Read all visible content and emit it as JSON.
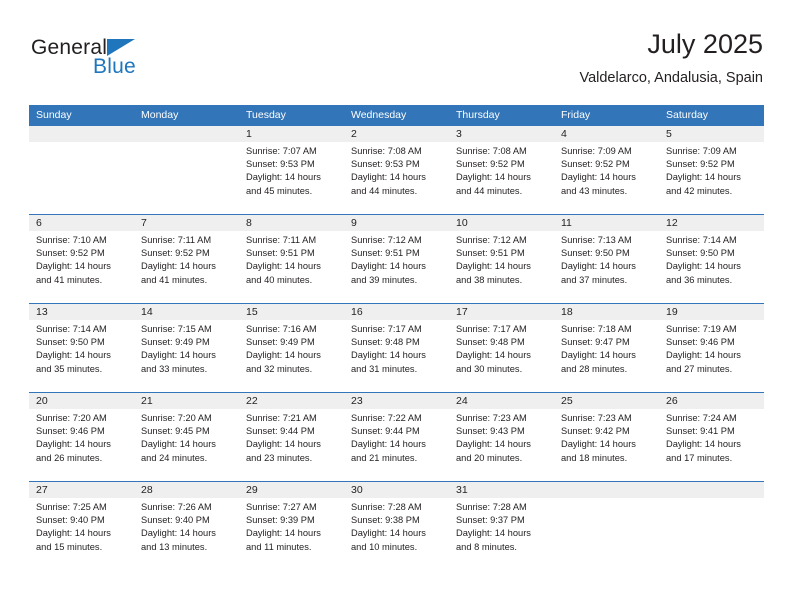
{
  "brand": {
    "name_dark": "General",
    "name_blue": "Blue",
    "accent_color": "#1f76bc"
  },
  "header": {
    "title": "July 2025",
    "subtitle": "Valdelarco, Andalusia, Spain"
  },
  "calendar": {
    "header_bg": "#3275b8",
    "daynum_bg": "#efefef",
    "weekday_headers": [
      "Sunday",
      "Monday",
      "Tuesday",
      "Wednesday",
      "Thursday",
      "Friday",
      "Saturday"
    ],
    "weeks": [
      [
        {
          "day": "",
          "lines": []
        },
        {
          "day": "",
          "lines": []
        },
        {
          "day": "1",
          "lines": [
            "Sunrise: 7:07 AM",
            "Sunset: 9:53 PM",
            "Daylight: 14 hours",
            "and 45 minutes."
          ]
        },
        {
          "day": "2",
          "lines": [
            "Sunrise: 7:08 AM",
            "Sunset: 9:53 PM",
            "Daylight: 14 hours",
            "and 44 minutes."
          ]
        },
        {
          "day": "3",
          "lines": [
            "Sunrise: 7:08 AM",
            "Sunset: 9:52 PM",
            "Daylight: 14 hours",
            "and 44 minutes."
          ]
        },
        {
          "day": "4",
          "lines": [
            "Sunrise: 7:09 AM",
            "Sunset: 9:52 PM",
            "Daylight: 14 hours",
            "and 43 minutes."
          ]
        },
        {
          "day": "5",
          "lines": [
            "Sunrise: 7:09 AM",
            "Sunset: 9:52 PM",
            "Daylight: 14 hours",
            "and 42 minutes."
          ]
        }
      ],
      [
        {
          "day": "6",
          "lines": [
            "Sunrise: 7:10 AM",
            "Sunset: 9:52 PM",
            "Daylight: 14 hours",
            "and 41 minutes."
          ]
        },
        {
          "day": "7",
          "lines": [
            "Sunrise: 7:11 AM",
            "Sunset: 9:52 PM",
            "Daylight: 14 hours",
            "and 41 minutes."
          ]
        },
        {
          "day": "8",
          "lines": [
            "Sunrise: 7:11 AM",
            "Sunset: 9:51 PM",
            "Daylight: 14 hours",
            "and 40 minutes."
          ]
        },
        {
          "day": "9",
          "lines": [
            "Sunrise: 7:12 AM",
            "Sunset: 9:51 PM",
            "Daylight: 14 hours",
            "and 39 minutes."
          ]
        },
        {
          "day": "10",
          "lines": [
            "Sunrise: 7:12 AM",
            "Sunset: 9:51 PM",
            "Daylight: 14 hours",
            "and 38 minutes."
          ]
        },
        {
          "day": "11",
          "lines": [
            "Sunrise: 7:13 AM",
            "Sunset: 9:50 PM",
            "Daylight: 14 hours",
            "and 37 minutes."
          ]
        },
        {
          "day": "12",
          "lines": [
            "Sunrise: 7:14 AM",
            "Sunset: 9:50 PM",
            "Daylight: 14 hours",
            "and 36 minutes."
          ]
        }
      ],
      [
        {
          "day": "13",
          "lines": [
            "Sunrise: 7:14 AM",
            "Sunset: 9:50 PM",
            "Daylight: 14 hours",
            "and 35 minutes."
          ]
        },
        {
          "day": "14",
          "lines": [
            "Sunrise: 7:15 AM",
            "Sunset: 9:49 PM",
            "Daylight: 14 hours",
            "and 33 minutes."
          ]
        },
        {
          "day": "15",
          "lines": [
            "Sunrise: 7:16 AM",
            "Sunset: 9:49 PM",
            "Daylight: 14 hours",
            "and 32 minutes."
          ]
        },
        {
          "day": "16",
          "lines": [
            "Sunrise: 7:17 AM",
            "Sunset: 9:48 PM",
            "Daylight: 14 hours",
            "and 31 minutes."
          ]
        },
        {
          "day": "17",
          "lines": [
            "Sunrise: 7:17 AM",
            "Sunset: 9:48 PM",
            "Daylight: 14 hours",
            "and 30 minutes."
          ]
        },
        {
          "day": "18",
          "lines": [
            "Sunrise: 7:18 AM",
            "Sunset: 9:47 PM",
            "Daylight: 14 hours",
            "and 28 minutes."
          ]
        },
        {
          "day": "19",
          "lines": [
            "Sunrise: 7:19 AM",
            "Sunset: 9:46 PM",
            "Daylight: 14 hours",
            "and 27 minutes."
          ]
        }
      ],
      [
        {
          "day": "20",
          "lines": [
            "Sunrise: 7:20 AM",
            "Sunset: 9:46 PM",
            "Daylight: 14 hours",
            "and 26 minutes."
          ]
        },
        {
          "day": "21",
          "lines": [
            "Sunrise: 7:20 AM",
            "Sunset: 9:45 PM",
            "Daylight: 14 hours",
            "and 24 minutes."
          ]
        },
        {
          "day": "22",
          "lines": [
            "Sunrise: 7:21 AM",
            "Sunset: 9:44 PM",
            "Daylight: 14 hours",
            "and 23 minutes."
          ]
        },
        {
          "day": "23",
          "lines": [
            "Sunrise: 7:22 AM",
            "Sunset: 9:44 PM",
            "Daylight: 14 hours",
            "and 21 minutes."
          ]
        },
        {
          "day": "24",
          "lines": [
            "Sunrise: 7:23 AM",
            "Sunset: 9:43 PM",
            "Daylight: 14 hours",
            "and 20 minutes."
          ]
        },
        {
          "day": "25",
          "lines": [
            "Sunrise: 7:23 AM",
            "Sunset: 9:42 PM",
            "Daylight: 14 hours",
            "and 18 minutes."
          ]
        },
        {
          "day": "26",
          "lines": [
            "Sunrise: 7:24 AM",
            "Sunset: 9:41 PM",
            "Daylight: 14 hours",
            "and 17 minutes."
          ]
        }
      ],
      [
        {
          "day": "27",
          "lines": [
            "Sunrise: 7:25 AM",
            "Sunset: 9:40 PM",
            "Daylight: 14 hours",
            "and 15 minutes."
          ]
        },
        {
          "day": "28",
          "lines": [
            "Sunrise: 7:26 AM",
            "Sunset: 9:40 PM",
            "Daylight: 14 hours",
            "and 13 minutes."
          ]
        },
        {
          "day": "29",
          "lines": [
            "Sunrise: 7:27 AM",
            "Sunset: 9:39 PM",
            "Daylight: 14 hours",
            "and 11 minutes."
          ]
        },
        {
          "day": "30",
          "lines": [
            "Sunrise: 7:28 AM",
            "Sunset: 9:38 PM",
            "Daylight: 14 hours",
            "and 10 minutes."
          ]
        },
        {
          "day": "31",
          "lines": [
            "Sunrise: 7:28 AM",
            "Sunset: 9:37 PM",
            "Daylight: 14 hours",
            "and 8 minutes."
          ]
        },
        {
          "day": "",
          "lines": []
        },
        {
          "day": "",
          "lines": []
        }
      ]
    ]
  }
}
